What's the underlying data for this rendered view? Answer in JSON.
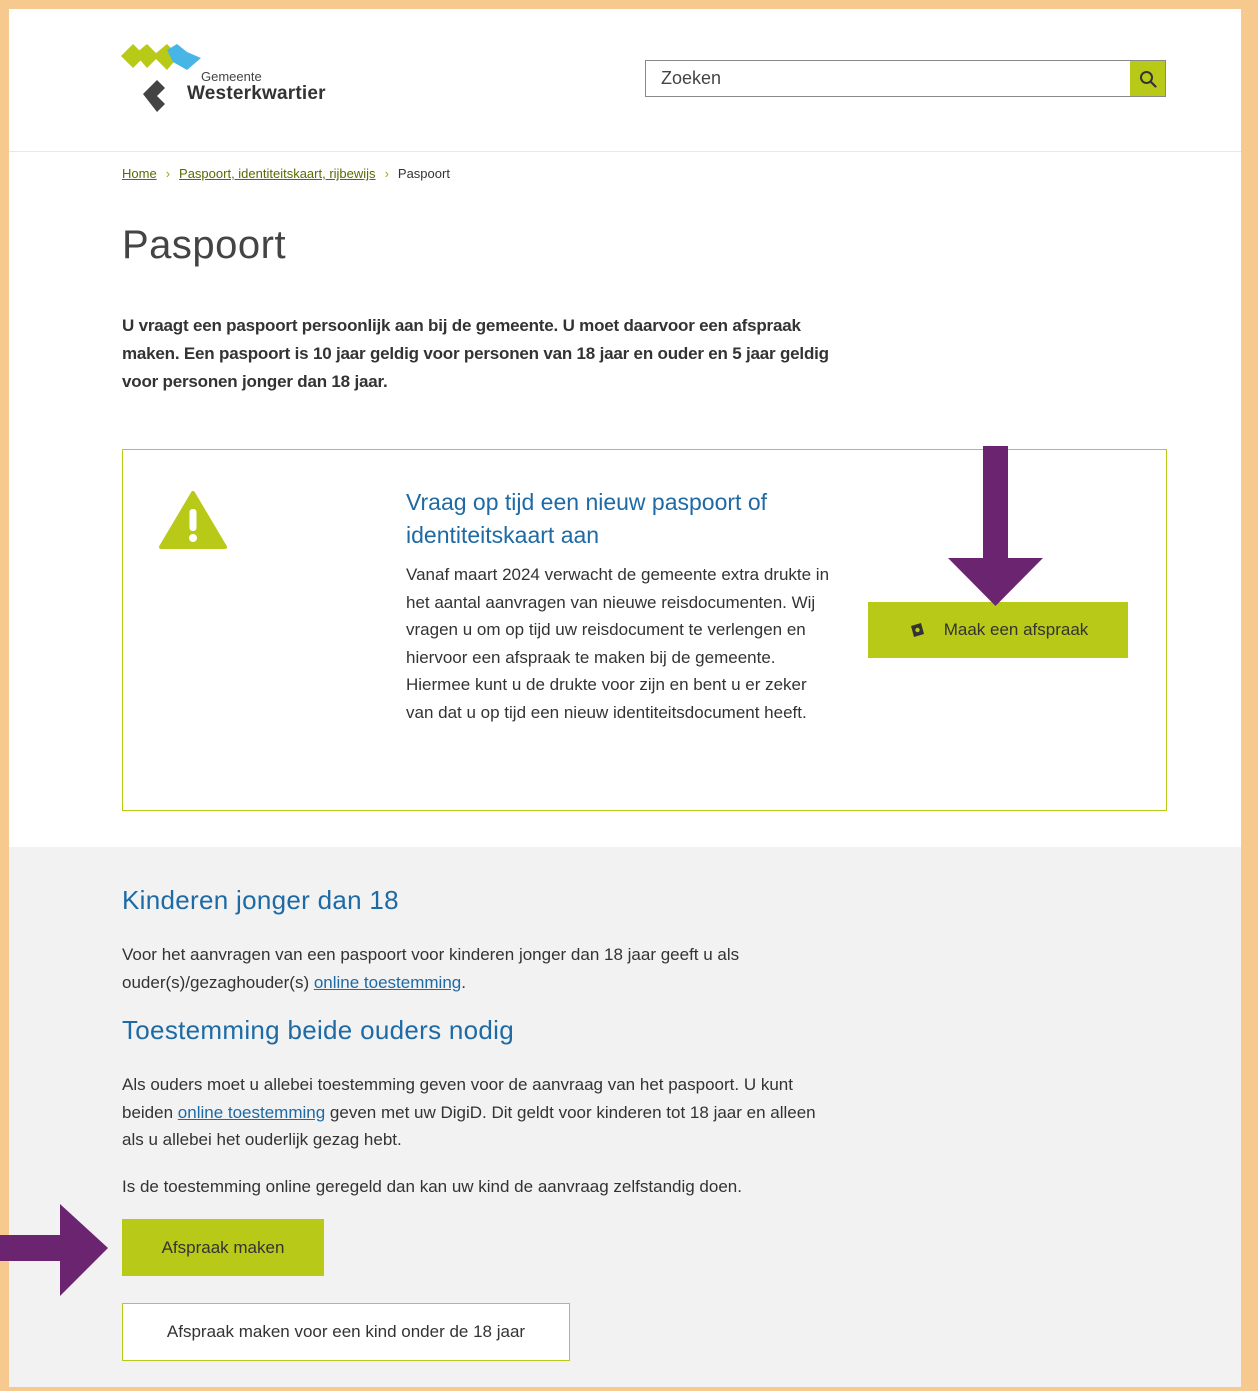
{
  "header": {
    "logo_small": "Gemeente",
    "logo_big": "Westerkwartier",
    "search_placeholder": "Zoeken",
    "colors": {
      "logo_green": "#b9c918",
      "logo_blue": "#47b5e6",
      "logo_dark": "#444444"
    }
  },
  "breadcrumb": {
    "items": [
      {
        "label": "Home"
      },
      {
        "label": "Paspoort, identiteitskaart, rijbewijs"
      }
    ],
    "current": "Paspoort"
  },
  "page": {
    "title": "Paspoort",
    "intro": "U vraagt een paspoort persoonlijk aan bij de gemeente. U moet daarvoor een afspraak maken. Een paspoort is 10 jaar geldig voor personen van 18 jaar en ouder en 5 jaar geldig voor personen jonger dan 18 jaar."
  },
  "notice": {
    "icon": "warning-icon",
    "heading": "Vraag op tijd een nieuw paspoort of identiteitskaart aan",
    "body": "Vanaf maart 2024 verwacht de gemeente extra drukte in het aantal aanvragen van nieuwe reisdocumenten. Wij vragen u om op tijd uw reisdocument te verlengen en hiervoor een afspraak te maken bij de gemeente. Hiermee kunt u de drukte voor zijn en bent u er zeker van dat u op tijd een nieuw identiteitsdocument heeft.",
    "button_label": "Maak een afspraak",
    "button_icon": "calendar-icon"
  },
  "children": {
    "heading": "Kinderen jonger dan 18",
    "text_before": "Voor het aanvragen van een paspoort voor kinderen jonger dan 18 jaar geeft u als ouder(s)/gezaghouder(s) ",
    "link": "online toestemming",
    "text_after": "."
  },
  "consent": {
    "heading": "Toestemming beide ouders nodig",
    "text_before": "Als ouders moet u allebei toestemming geven voor de aanvraag van het paspoort. U kunt beiden ",
    "link": "online toestemming",
    "text_after": " geven met uw DigiD. Dit geldt voor kinderen tot 18 jaar en alleen als u allebei het ouderlijk gezag hebt.",
    "note": "Is de toestemming online geregeld dan kan uw kind de aanvraag zelfstandig doen.",
    "primary_button": "Afspraak maken",
    "secondary_button": "Afspraak maken voor een kind onder de 18 jaar"
  },
  "annotations": {
    "arrow_color": "#6b2470"
  }
}
